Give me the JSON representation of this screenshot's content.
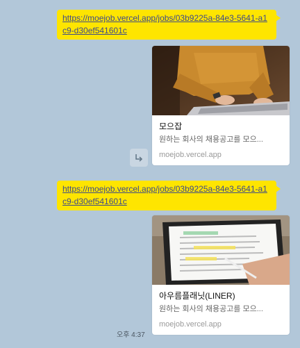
{
  "messages": [
    {
      "link": "https://moejob.vercel.app/jobs/03b9225a-84e3-5641-a1c9-d30ef541601c",
      "preview": {
        "title": "모으잡",
        "description": "원하는 회사의 채용공고를 모으...",
        "domain": "moejob.vercel.app",
        "image": "person-typing-laptop"
      }
    },
    {
      "link": "https://moejob.vercel.app/jobs/03b9225a-84e3-5641-a1c9-d30ef541601c",
      "preview": {
        "title": "아우름플래닛(LINER)",
        "description": "원하는 회사의 채용공고를 모으...",
        "domain": "moejob.vercel.app",
        "image": "tablet-highlighting-text"
      }
    }
  ],
  "timestamp": "오후 4:37",
  "colors": {
    "background": "#b2c7d9",
    "bubble": "#fee500",
    "link": "#3d4a8a"
  }
}
